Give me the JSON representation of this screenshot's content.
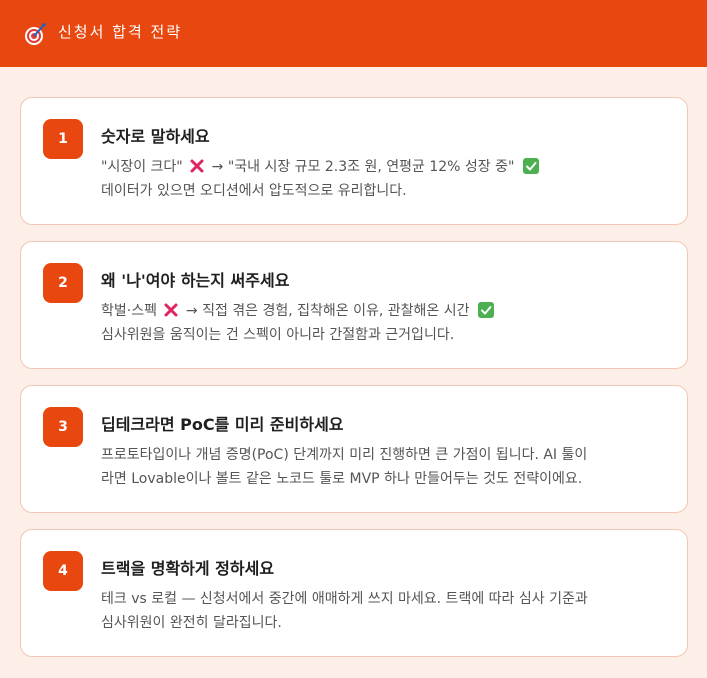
{
  "header": {
    "title": "신청서 합격 전략",
    "icon": "target-dart-icon",
    "color": "#e8470f"
  },
  "tips": [
    {
      "number": "1",
      "title": "숫자로 말하세요",
      "line1_before": "\"시장이 크다\"",
      "line1_after": "→ \"국내 시장 규모 2.3조 원, 연평균 12% 성장 중\"",
      "line2": "데이터가 있으면 오디션에서 압도적으로 유리합니다."
    },
    {
      "number": "2",
      "title": "왜 '나'여야 하는지 써주세요",
      "line1_before": "학벌·스펙",
      "line1_after": "→ 직접 겪은 경험, 집착해온 이유, 관찰해온 시간",
      "line2": "심사위원을 움직이는 건 스펙이 아니라 간절함과 근거입니다."
    },
    {
      "number": "3",
      "title": "딥테크라면 PoC를 미리 준비하세요",
      "line1": "프로토타입이나 개념 증명(PoC) 단계까지 미리 진행하면 큰 가점이 됩니다. AI 툴이",
      "line2": "라면 Lovable이나 볼트 같은 노코드 툴로 MVP 하나 만들어두는 것도 전략이에요."
    },
    {
      "number": "4",
      "title": "트랙을 명확하게 정하세요",
      "line1": "테크 vs 로컬 — 신청서에서 중간에 애매하게 쓰지 마세요. 트랙에 따라 심사 기준과",
      "line2": "심사위원이 완전히 달라집니다."
    }
  ]
}
